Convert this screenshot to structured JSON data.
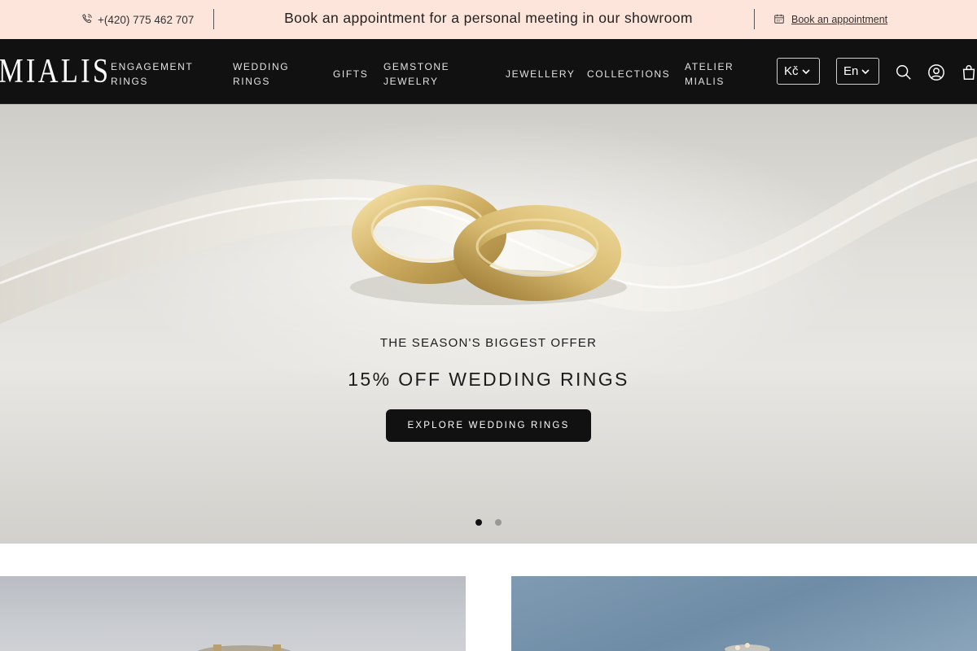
{
  "topbar": {
    "phone": "+(420) 775 462 707",
    "announcement": "Book an appointment for a personal meeting in our showroom",
    "book_link": "Book an appointment"
  },
  "nav": {
    "logo": "MIALIS",
    "items": [
      {
        "line1": "ENGAGEMENT",
        "line2": "RINGS"
      },
      {
        "line1": "WEDDING",
        "line2": "RINGS"
      },
      {
        "line1": "GIFTS",
        "line2": ""
      },
      {
        "line1": "GEMSTONE",
        "line2": "JEWELRY"
      },
      {
        "line1": "JEWELLERY",
        "line2": ""
      },
      {
        "line1": "COLLECTIONS",
        "line2": ""
      },
      {
        "line1": "ATELIER",
        "line2": "MIALIS"
      }
    ],
    "currency": "Kč",
    "language": "En",
    "icons": [
      "search-icon",
      "account-icon",
      "cart-icon"
    ]
  },
  "hero": {
    "subtitle": "THE SEASON'S BIGGEST OFFER",
    "title": "15% OFF WEDDING RINGS",
    "cta": "EXPLORE WEDDING RINGS",
    "slides_total": 2,
    "active_slide": 1
  },
  "colors": {
    "topbar_bg": "#fde5dc",
    "nav_bg": "#111111",
    "cta_bg": "#111111",
    "gold": "#d9bf7a"
  }
}
